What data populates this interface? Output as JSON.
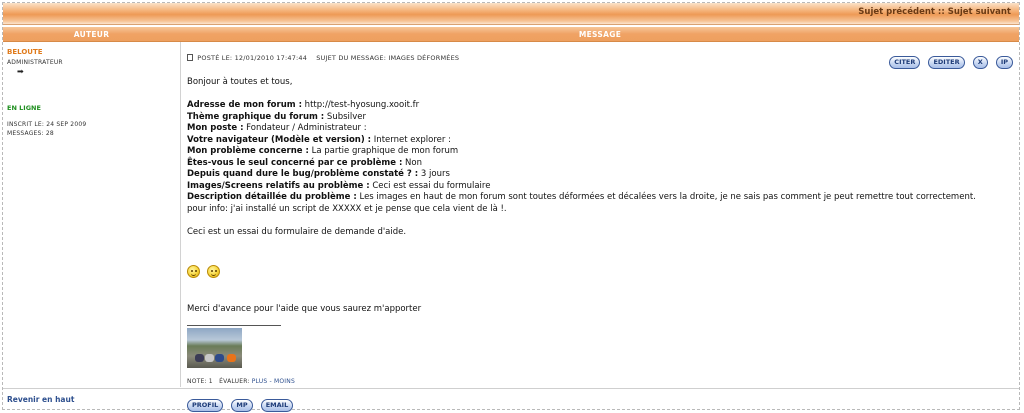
{
  "nav": {
    "prev_topic": "Sujet précédent",
    "separator": "::",
    "next_topic": "Sujet suivant"
  },
  "table_header": {
    "author": "Auteur",
    "message": "Message"
  },
  "author": {
    "name": "BELOUTE",
    "rank": "Administrateur",
    "rank_icon": "arrow-rank-icon",
    "status": "En ligne",
    "joined": "Inscrit le: 24 Sep 2009",
    "messages": "Messages: 28"
  },
  "post": {
    "posted": "Posté le: 12/01/2010 17:47:44",
    "subject": "Sujet du message: Images déformées",
    "buttons": {
      "quote": "Citer",
      "edit": "Editer",
      "delete": "X",
      "ip": "IP"
    },
    "greeting": "Bonjour à toutes et tous,",
    "fields": [
      {
        "label": "Adresse de mon forum :",
        "value": " http://test-hyosung.xooit.fr"
      },
      {
        "label": "Thème graphique du forum :",
        "value": " Subsilver"
      },
      {
        "label": "Mon poste :",
        "value": " Fondateur / Administrateur :"
      },
      {
        "label": "Votre navigateur (Modèle et version) :",
        "value": "      Internet explorer :"
      },
      {
        "label": "Mon problème concerne :",
        "value": " La partie graphique de mon forum"
      },
      {
        "label": "Êtes-vous le seul concerné par ce problème :",
        "value": " Non"
      },
      {
        "label": "Depuis quand dure le bug/problème constaté ? :",
        "value": " 3 jours"
      },
      {
        "label": "Images/Screens relatifs au problème :",
        "value": " Ceci est essai du formulaire"
      },
      {
        "label": "Description détaillée du problème :",
        "value": " Les images en haut de mon forum sont toutes déformées et décalées vers la droite, je ne sais pas comment je peut remettre tout correctement."
      }
    ],
    "extra_line": "pour info: j'ai installé un script de XXXXX et je pense que cela vient de là !.",
    "test_line": "Ceci est un essai du formulaire de demande d'aide.",
    "smileys": [
      "smile-icon",
      "grin-icon"
    ],
    "thanks": "Merci d'avance pour l'aide que vous saurez m'apporter",
    "rating": {
      "note": "Note: 1",
      "evaluate": "Évaluer:",
      "plus": "Plus",
      "dash": "-",
      "minus": "Moins"
    }
  },
  "footer": {
    "back_to_top": "Revenir en haut",
    "profile": "Profil",
    "pm": "MP",
    "email": "Email"
  },
  "colors": {
    "accent_orange": "#ee9a56",
    "author_name": "#e07b1c",
    "online_green": "#1f8f1f",
    "link_blue": "#2d4f8e"
  }
}
